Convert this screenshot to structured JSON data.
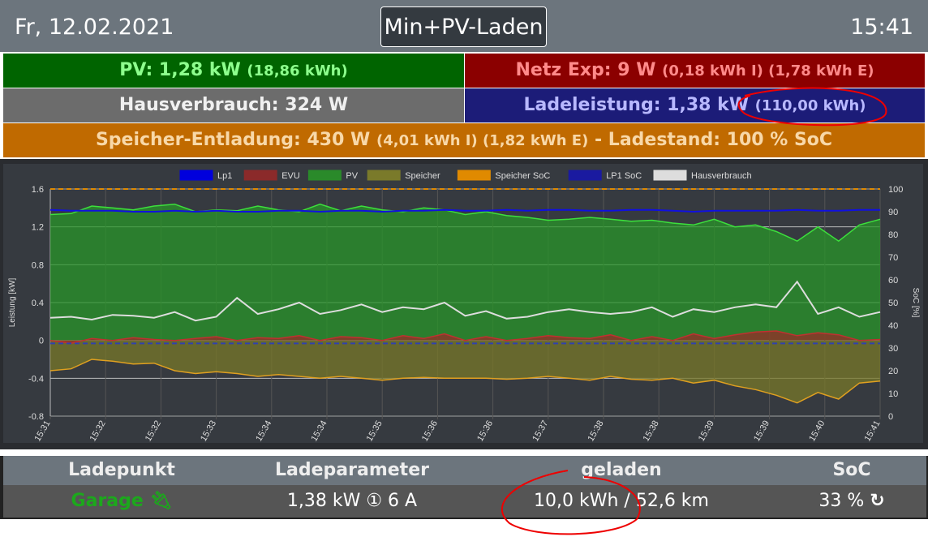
{
  "header": {
    "date": "Fr, 12.02.2021",
    "mode": "Min+PV-Laden",
    "time": "15:41"
  },
  "status": {
    "pv": {
      "label": "PV: 1,28 kW",
      "extra": "(18,86 kWh)"
    },
    "netz": {
      "label": "Netz Exp: 9 W",
      "extra": "(0,18 kWh I) (1,78 kWh E)"
    },
    "haus": {
      "label": "Hausverbrauch: 324 W"
    },
    "lade": {
      "label": "Ladeleistung: 1,38 kW",
      "extra": "(110,00 kWh)"
    },
    "speicher": {
      "label": "Speicher-Entladung: 430 W",
      "extra": "(4,01 kWh I) (1,82 kWh E)",
      "soc": "- Ladestand: 100 % SoC"
    }
  },
  "colors": {
    "pv_bg": "#006400",
    "netz_bg": "#8b0000",
    "haus_bg": "#6c6c6c",
    "lade_bg": "#1c1c78",
    "speicher_bg": "#c06a00"
  },
  "chart_data": {
    "type": "area",
    "ylabel": "Leistung [kW]",
    "y2label": "SoC [%]",
    "ylim": [
      -0.8,
      1.6
    ],
    "y2lim": [
      0,
      100
    ],
    "yticks": [
      "1.6",
      "1.2",
      "0.8",
      "0.4",
      "0",
      "-0.4",
      "-0.8"
    ],
    "y2ticks": [
      "100",
      "90",
      "80",
      "70",
      "60",
      "50",
      "40",
      "30",
      "20",
      "10",
      "0"
    ],
    "xticks": [
      "15:31",
      "15:32",
      "15:32",
      "15:33",
      "15:34",
      "15:34",
      "15:35",
      "15:36",
      "15:36",
      "15:37",
      "15:38",
      "15:38",
      "15:39",
      "15:39",
      "15:40",
      "15:41"
    ],
    "legend": [
      {
        "name": "Lp1",
        "color": "#0000dd"
      },
      {
        "name": "EVU",
        "color": "#8b2a2a"
      },
      {
        "name": "PV",
        "color": "#2a8a2a"
      },
      {
        "name": "Speicher",
        "color": "#7a7a2a"
      },
      {
        "name": "Speicher SoC",
        "color": "#e08a00"
      },
      {
        "name": "LP1 SoC",
        "color": "#1a1aa0"
      },
      {
        "name": "Hausverbrauch",
        "color": "#dddddd"
      }
    ],
    "series": {
      "pv": [
        1.33,
        1.34,
        1.42,
        1.4,
        1.38,
        1.42,
        1.44,
        1.36,
        1.38,
        1.37,
        1.42,
        1.38,
        1.36,
        1.44,
        1.37,
        1.42,
        1.38,
        1.36,
        1.4,
        1.38,
        1.33,
        1.36,
        1.32,
        1.3,
        1.27,
        1.28,
        1.3,
        1.28,
        1.26,
        1.27,
        1.24,
        1.22,
        1.28,
        1.2,
        1.22,
        1.15,
        1.05,
        1.2,
        1.05,
        1.22,
        1.28
      ],
      "haus": [
        0.24,
        0.25,
        0.22,
        0.27,
        0.26,
        0.24,
        0.3,
        0.21,
        0.25,
        0.45,
        0.28,
        0.33,
        0.4,
        0.28,
        0.32,
        0.38,
        0.3,
        0.35,
        0.33,
        0.4,
        0.26,
        0.31,
        0.23,
        0.25,
        0.3,
        0.33,
        0.3,
        0.28,
        0.3,
        0.35,
        0.25,
        0.33,
        0.3,
        0.35,
        0.38,
        0.35,
        0.62,
        0.28,
        0.35,
        0.25,
        0.3
      ],
      "speicher": [
        -0.32,
        -0.3,
        -0.2,
        -0.22,
        -0.25,
        -0.24,
        -0.32,
        -0.35,
        -0.33,
        -0.35,
        -0.38,
        -0.36,
        -0.38,
        -0.4,
        -0.38,
        -0.4,
        -0.42,
        -0.4,
        -0.39,
        -0.4,
        -0.4,
        -0.4,
        -0.41,
        -0.4,
        -0.38,
        -0.4,
        -0.42,
        -0.38,
        -0.41,
        -0.42,
        -0.4,
        -0.45,
        -0.42,
        -0.48,
        -0.52,
        -0.58,
        -0.66,
        -0.55,
        -0.62,
        -0.45,
        -0.43
      ],
      "evu": [
        0.0,
        -0.03,
        0.02,
        0.0,
        0.03,
        0.01,
        0.0,
        0.02,
        0.04,
        0.0,
        0.03,
        0.02,
        0.05,
        0.0,
        0.04,
        0.03,
        0.0,
        0.05,
        0.02,
        0.07,
        0.0,
        0.04,
        0.0,
        0.02,
        0.05,
        0.03,
        0.02,
        0.06,
        0.0,
        0.04,
        0.0,
        0.07,
        0.02,
        0.06,
        0.09,
        0.1,
        0.05,
        0.08,
        0.06,
        0.0,
        0.01
      ],
      "lp1": [
        1.38,
        1.37,
        1.37,
        1.37,
        1.36,
        1.36,
        1.37,
        1.36,
        1.37,
        1.36,
        1.36,
        1.37,
        1.37,
        1.36,
        1.37,
        1.37,
        1.36,
        1.37,
        1.37,
        1.38,
        1.37,
        1.37,
        1.38,
        1.37,
        1.38,
        1.38,
        1.37,
        1.37,
        1.38,
        1.38,
        1.37,
        1.36,
        1.37,
        1.37,
        1.37,
        1.37,
        1.38,
        1.37,
        1.37,
        1.38,
        1.38
      ],
      "speicher_soc": 100,
      "lp1_soc": 32
    }
  },
  "table": {
    "headers": [
      "Ladepunkt",
      "Ladeparameter",
      "geladen",
      "SoC"
    ],
    "row": {
      "name": "Garage",
      "params": "1,38 kW ① 6 A",
      "charged": "10,0 kWh / 52,6 km",
      "soc": "33 %"
    }
  }
}
